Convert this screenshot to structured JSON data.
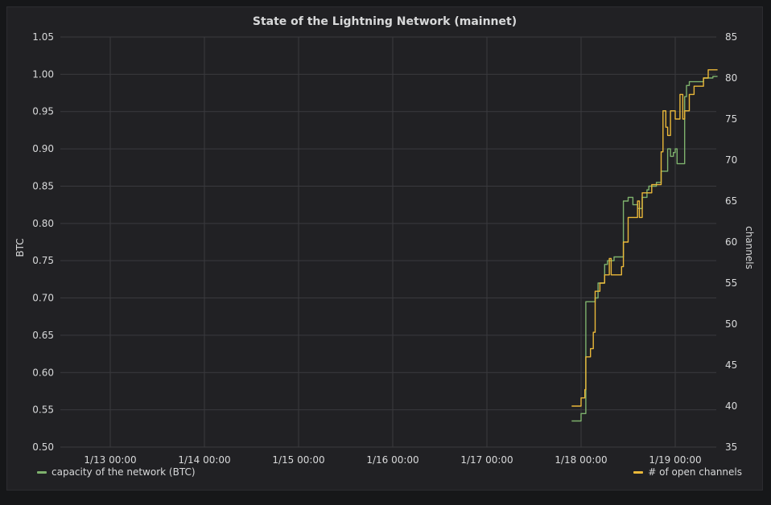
{
  "panel": {
    "title": "State of the Lightning Network (mainnet)"
  },
  "chart_data": {
    "type": "line",
    "title": "State of the Lightning Network (mainnet)",
    "x_ticks": [
      "1/13 00:00",
      "1/14 00:00",
      "1/15 00:00",
      "1/16 00:00",
      "1/17 00:00",
      "1/18 00:00",
      "1/19 00:00"
    ],
    "xlim": [
      "1/12 08:00",
      "1/19 11:30"
    ],
    "ylabel": "BTC",
    "ylim": [
      0.5,
      1.05
    ],
    "y_ticks": [
      "0.50",
      "0.55",
      "0.60",
      "0.65",
      "0.70",
      "0.75",
      "0.80",
      "0.85",
      "0.90",
      "0.95",
      "1.00",
      "1.05"
    ],
    "y2label": "channels",
    "y2lim": [
      35,
      85
    ],
    "y2_ticks": [
      "35",
      "40",
      "45",
      "50",
      "55",
      "60",
      "65",
      "70",
      "75",
      "80",
      "85"
    ],
    "grid": true,
    "legend_placement": "bottom",
    "series": [
      {
        "name": "capacity of the network (BTC)",
        "axis": "left",
        "color": "#7eb26d",
        "x": [
          -0.1,
          -0.05,
          0.0,
          0.01,
          0.04,
          0.05,
          0.15,
          0.18,
          0.2,
          0.25,
          0.28,
          0.35,
          0.4,
          0.45,
          0.5,
          0.55,
          0.6,
          0.65,
          0.7,
          0.72,
          0.75,
          0.8,
          0.85,
          0.9,
          0.92,
          0.95,
          0.98,
          1.0,
          1.02,
          1.05,
          1.1,
          1.12,
          1.15,
          1.2,
          1.25,
          1.3,
          1.35,
          1.4,
          1.45
        ],
        "y": [
          0.535,
          0.535,
          0.545,
          0.545,
          0.545,
          0.695,
          0.7,
          0.72,
          0.72,
          0.745,
          0.75,
          0.755,
          0.755,
          0.83,
          0.835,
          0.825,
          0.82,
          0.835,
          0.845,
          0.85,
          0.85,
          0.855,
          0.87,
          0.87,
          0.9,
          0.89,
          0.895,
          0.9,
          0.88,
          0.88,
          0.97,
          0.985,
          0.99,
          0.99,
          0.99,
          0.995,
          0.995,
          0.997,
          0.997
        ]
      },
      {
        "name": "# of open channels",
        "axis": "right",
        "color": "#eab839",
        "x": [
          -0.1,
          -0.02,
          0.0,
          0.02,
          0.04,
          0.05,
          0.1,
          0.13,
          0.15,
          0.2,
          0.25,
          0.3,
          0.32,
          0.35,
          0.38,
          0.43,
          0.45,
          0.5,
          0.55,
          0.58,
          0.6,
          0.62,
          0.65,
          0.7,
          0.75,
          0.8,
          0.85,
          0.87,
          0.9,
          0.92,
          0.95,
          1.0,
          1.05,
          1.08,
          1.1,
          1.15,
          1.2,
          1.25,
          1.3,
          1.35,
          1.4,
          1.45
        ],
        "y": [
          40,
          40,
          41,
          41,
          42,
          46,
          47,
          49,
          54,
          55,
          56,
          58,
          56,
          56,
          56,
          57,
          60,
          63,
          63,
          63,
          65,
          63,
          66,
          66,
          67,
          67,
          71,
          76,
          74,
          73,
          76,
          75,
          78,
          75,
          76,
          78,
          79,
          79,
          80,
          81,
          81,
          81
        ]
      }
    ]
  }
}
